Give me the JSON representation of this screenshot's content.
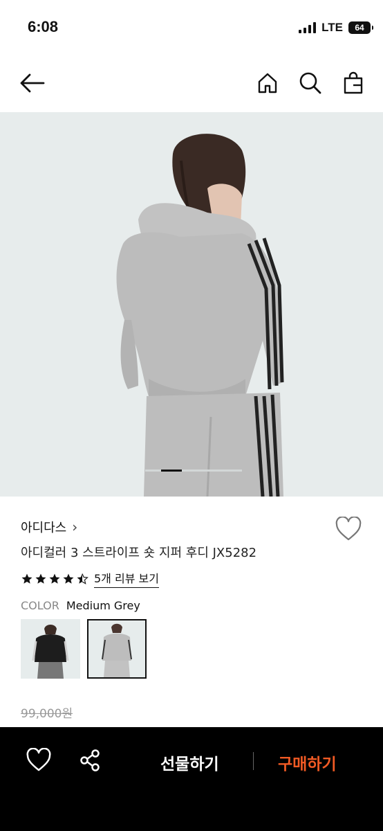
{
  "status": {
    "time": "6:08",
    "network": "LTE",
    "battery": "64"
  },
  "nav": {
    "icons": [
      "back-arrow-icon",
      "home-icon",
      "search-icon",
      "shopping-bag-icon"
    ]
  },
  "product": {
    "brand": "아디다스",
    "brand_chevron": "›",
    "title": "아디컬러 3 스트라이프 숏 지퍼 후디 JX5282",
    "rating": 4.5,
    "review_link": "5개 리뷰 보기",
    "color_label": "COLOR",
    "color_value": "Medium Grey",
    "original_price": "99,000원",
    "carousel_position": 1,
    "carousel_count": 5
  },
  "colors": {
    "star": "#111111",
    "buy_button": "#f15a24",
    "bottom_bar": "#000000",
    "hero_bg": "#e7ecec"
  },
  "bottom_bar": {
    "gift_label": "선물하기",
    "buy_label": "구매하기"
  }
}
